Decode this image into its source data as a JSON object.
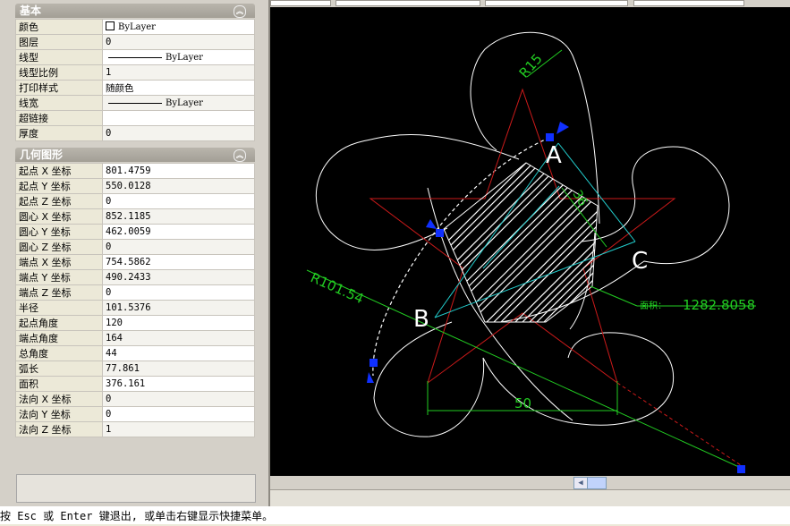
{
  "palette": {
    "basic_section": {
      "title": "基本",
      "rows": [
        {
          "name": "颜色",
          "value": "ByLayer"
        },
        {
          "name": "图层",
          "value": "0"
        },
        {
          "name": "线型",
          "value": "ByLayer"
        },
        {
          "name": "线型比例",
          "value": "1"
        },
        {
          "name": "打印样式",
          "value": "随颜色"
        },
        {
          "name": "线宽",
          "value": "ByLayer"
        },
        {
          "name": "超链接",
          "value": ""
        },
        {
          "name": "厚度",
          "value": "0"
        }
      ]
    },
    "geometry_section": {
      "title": "几何图形",
      "rows": [
        {
          "name": "起点 X 坐标",
          "value": "801.4759"
        },
        {
          "name": "起点 Y 坐标",
          "value": "550.0128"
        },
        {
          "name": "起点 Z 坐标",
          "value": "0"
        },
        {
          "name": "圆心 X 坐标",
          "value": "852.1185"
        },
        {
          "name": "圆心 Y 坐标",
          "value": "462.0059"
        },
        {
          "name": "圆心 Z 坐标",
          "value": "0"
        },
        {
          "name": "端点 X 坐标",
          "value": "754.5862"
        },
        {
          "name": "端点 Y 坐标",
          "value": "490.2433"
        },
        {
          "name": "端点 Z 坐标",
          "value": "0"
        },
        {
          "name": "半径",
          "value": "101.5376"
        },
        {
          "name": "起点角度",
          "value": "120"
        },
        {
          "name": "端点角度",
          "value": "164"
        },
        {
          "name": "总角度",
          "value": "44"
        },
        {
          "name": "弧长",
          "value": "77.861"
        },
        {
          "name": "面积",
          "value": "376.161"
        },
        {
          "name": "法向 X 坐标",
          "value": "0"
        },
        {
          "name": "法向 Y 坐标",
          "value": "0"
        },
        {
          "name": "法向 Z 坐标",
          "value": "1"
        }
      ]
    }
  },
  "drawing": {
    "label_r15": "R15",
    "label_a": "A",
    "label_b": "B",
    "label_c": "C",
    "label_36": "36",
    "label_r101": "R101.54",
    "area_prefix": "面积：",
    "area_value": "1282.8058",
    "dim_50": "50",
    "colors": {
      "star": "#cc1a1a",
      "dimension": "#22cc22",
      "grip": "#1030ff",
      "construction": "#22cccc"
    }
  },
  "command_line": {
    "text": "按 Esc 或 Enter 键退出, 或单击右键显示快捷菜单。"
  }
}
